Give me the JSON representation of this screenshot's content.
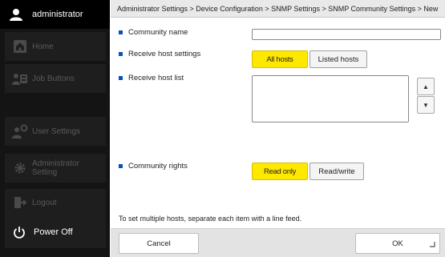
{
  "user": {
    "name": "administrator",
    "icon": "user-icon"
  },
  "sidebar": {
    "items": [
      {
        "label": "Home",
        "icon": "home-icon"
      },
      {
        "label": "Job Buttons",
        "icon": "job-buttons-icon"
      },
      {
        "label": "User Settings",
        "icon": "user-settings-icon"
      },
      {
        "label": "Administrator Setting",
        "icon": "gear-icon"
      },
      {
        "label": "Logout",
        "icon": "logout-icon"
      }
    ],
    "power": {
      "label": "Power Off",
      "icon": "power-icon"
    }
  },
  "breadcrumb": "Administrator Settings > Device Configuration > SNMP Settings > SNMP Community Settings > New",
  "form": {
    "community_name": {
      "label": "Community name",
      "value": ""
    },
    "receive_host_settings": {
      "label": "Receive host settings",
      "options": [
        "All hosts",
        "Listed hosts"
      ],
      "selected": "All hosts"
    },
    "receive_host_list": {
      "label": "Receive host list",
      "value": ""
    },
    "community_rights": {
      "label": "Community rights",
      "options": [
        "Read only",
        "Read/write"
      ],
      "selected": "Read only"
    }
  },
  "note": "To set multiple hosts, separate each item with a line feed.",
  "footer": {
    "cancel_label": "Cancel",
    "ok_label": "OK"
  },
  "colors": {
    "selected": "#ffe800",
    "bullet": "#0a4fbf",
    "sidebar_bg": "#141414"
  }
}
